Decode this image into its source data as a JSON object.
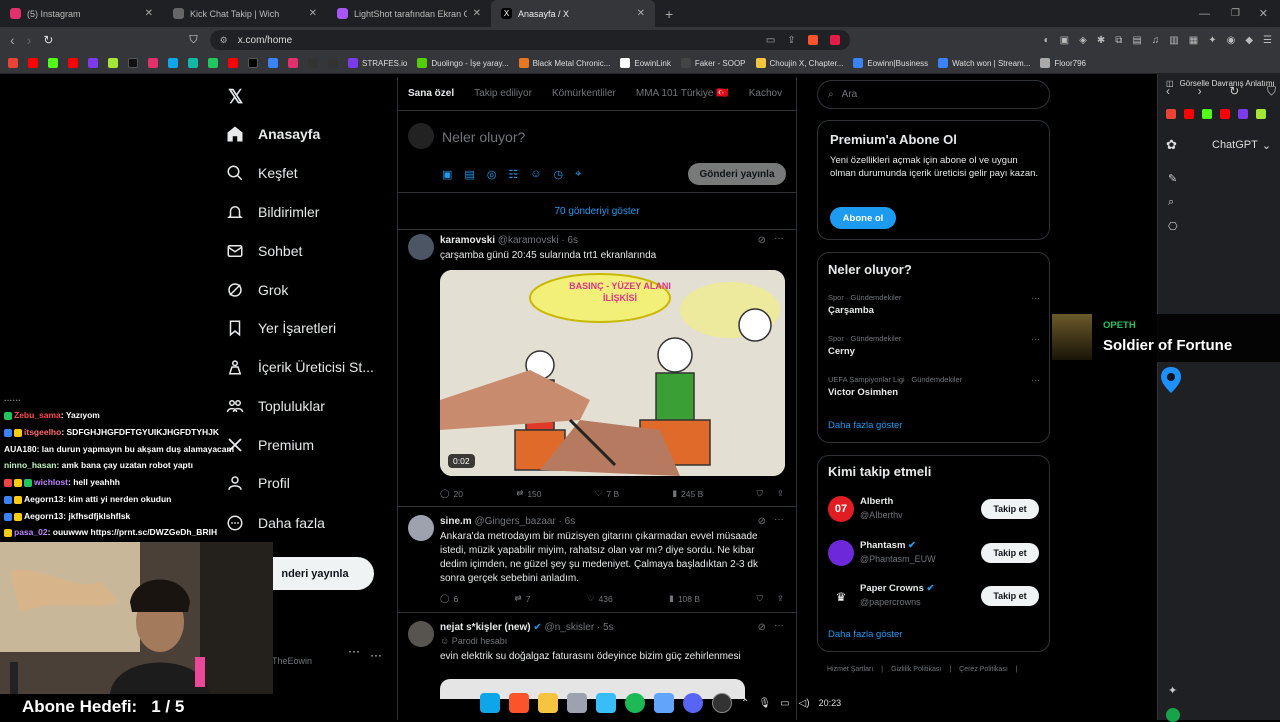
{
  "browser": {
    "tabs": [
      {
        "label": "(5) Instagram",
        "color": "#e1306c"
      },
      {
        "label": "Kick Chat Takip | Wich",
        "color": "#888888"
      },
      {
        "label": "LightShot tarafından Ekran Görüntü",
        "color": "#a855f7"
      },
      {
        "label": "Anasayfa / X",
        "color": "#ffffff",
        "active": true
      }
    ],
    "url": "x.com/home",
    "bookmarks": [
      {
        "label": "STRAFES.io",
        "color": "#7c3aed"
      },
      {
        "label": "Duolingo - İşe yaray...",
        "color": "#58cc02"
      },
      {
        "label": "Black Metal Chronic...",
        "color": "#e87722"
      },
      {
        "label": "EowinLink",
        "color": "#ffffff"
      },
      {
        "label": "Faker - SOOP",
        "color": "#1a1a1a"
      },
      {
        "label": "Choujin X, Chapter...",
        "color": "#f5c542"
      },
      {
        "label": "Eowinn|Business",
        "color": "#3b82f6"
      },
      {
        "label": "Watch won | Stream...",
        "color": "#3b82f6"
      },
      {
        "label": "Floor796",
        "color": "#aaaaaa"
      }
    ]
  },
  "x_nav": {
    "items": [
      {
        "label": "Anasayfa",
        "icon": "home-icon"
      },
      {
        "label": "Keşfet",
        "icon": "search-icon"
      },
      {
        "label": "Bildirimler",
        "icon": "bell-icon"
      },
      {
        "label": "Sohbet",
        "icon": "mail-icon"
      },
      {
        "label": "Grok",
        "icon": "grok-icon"
      },
      {
        "label": "Yer İşaretleri",
        "icon": "bookmark-icon"
      },
      {
        "label": "İçerik Üreticisi St...",
        "icon": "creator-icon"
      },
      {
        "label": "Topluluklar",
        "icon": "communities-icon"
      },
      {
        "label": "Premium",
        "icon": "x-icon"
      },
      {
        "label": "Profil",
        "icon": "person-icon"
      },
      {
        "label": "Daha fazla",
        "icon": "more-icon"
      }
    ],
    "post_button": "nderi yayınla",
    "account": "TheEowin"
  },
  "feed": {
    "tabs": [
      "Sana özel",
      "Takip ediliyor",
      "Kömürkentliler",
      "MMA 101 Türkiye 🇹🇷",
      "Kachov"
    ],
    "composer_placeholder": "Neler oluyor?",
    "post_button": "Gönderi yayınla",
    "show_more": "70 gönderiyi göster",
    "posts": [
      {
        "name": "karamovski",
        "handle": "@karamovski · 6s",
        "text": "çarşamba günü 20:45 sularında trt1 ekranlarında",
        "media_duration": "0:02",
        "video_caption": "BASINÇ - YÜZEY ALANI İLİŞKİSİ",
        "replies": "20",
        "reposts": "150",
        "likes": "7 B",
        "views": "245 B"
      },
      {
        "name": "sine.m",
        "handle": "@Gingers_bazaar · 6s",
        "text": "Ankara'da metrodayım bir müzisyen gitarını çıkarmadan evvel müsaade istedi, müzik yapabilir miyim, rahatsız olan var mı? diye sordu. Ne kibar dedim içimden, ne güzel şey şu medeniyet. Çalmaya başladıktan 2-3 dk sonra gerçek sebebini anladım.",
        "replies": "6",
        "reposts": "7",
        "likes": "436",
        "views": "108 B"
      },
      {
        "name": "nejat s*kişler (new)",
        "handle": "@n_skisler · 5s",
        "parody": "Parodi hesabı",
        "text": "evin elektrik su doğalgaz faturasını ödeyince bizim güç zehirlenmesi"
      }
    ]
  },
  "right": {
    "search_placeholder": "Ara",
    "premium": {
      "title": "Premium'a Abone Ol",
      "text": "Yeni özellikleri açmak için abone ol ve uygun olman durumunda içerik üreticisi gelir payı kazan.",
      "button": "Abone ol"
    },
    "trends": {
      "title": "Neler oluyor?",
      "items": [
        {
          "sub": "Spor · Gündemdekiler",
          "name": "Çarşamba"
        },
        {
          "sub": "Spor · Gündemdekiler",
          "name": "Cerny"
        },
        {
          "sub": "UEFA Şampiyonlar Ligi · Gündemdekiler",
          "name": "Victor Osimhen"
        }
      ],
      "more": "Daha fazla göster"
    },
    "who_to_follow": {
      "title": "Kimi takip etmeli",
      "items": [
        {
          "name": "Alberth",
          "handle": "@AIberthv",
          "button": "Takip et",
          "color": "#e11d24"
        },
        {
          "name": "Phantasm",
          "handle": "@Phantasm_EUW",
          "button": "Takip et",
          "color": "#6d28d9"
        },
        {
          "name": "Paper Crowns",
          "handle": "@papercrowns",
          "button": "Takip et",
          "color": "#000000"
        }
      ],
      "more": "Daha fazla göster"
    },
    "footer": [
      "Hizmet Şartları",
      "Gizlilik Politikası",
      "Çerez Politikası"
    ]
  },
  "sidepanel": {
    "header": "Görselle Davranış Anlatımı",
    "title": "ChatGPT"
  },
  "music": {
    "artist": "OPETH",
    "title": "Soldier of Fortune"
  },
  "chat": [
    {
      "user": "Zebu_sama",
      "color": "#ff4d4d",
      "msg": ": Yazıyom"
    },
    {
      "user": "itsgeelho",
      "color": "#ff6b6b",
      "msg": ": SDFGHJHGFDFTGYUIKJHGFDTYHJK"
    },
    {
      "user": "AUA180",
      "color": "#ffffff",
      "msg": ": lan durun yapmayın bu akşam duş alamayacam"
    },
    {
      "user": "ninno_hasan",
      "color": "#c3f5c3",
      "msg": ": amk bana çay uzatan robot yaptı"
    },
    {
      "user": "wichlost",
      "color": "#c084fc",
      "msg": ": hell yeahhh"
    },
    {
      "user": "Aegorn13",
      "color": "#ffffff",
      "msg": ": kim atti yi nerden okudun"
    },
    {
      "user": "Aegorn13",
      "color": "#ffffff",
      "msg": ": jkfhsdfjklshflsk"
    },
    {
      "user": "pasa_02",
      "color": "#c084fc",
      "msg": ": ouuwww https://prnt.sc/DWZGeDh_BRIH"
    }
  ],
  "overlay": {
    "goal_label": "Abone Hedefi:",
    "goal_value": "1 / 5"
  },
  "taskbar": {
    "time": "20:23"
  }
}
